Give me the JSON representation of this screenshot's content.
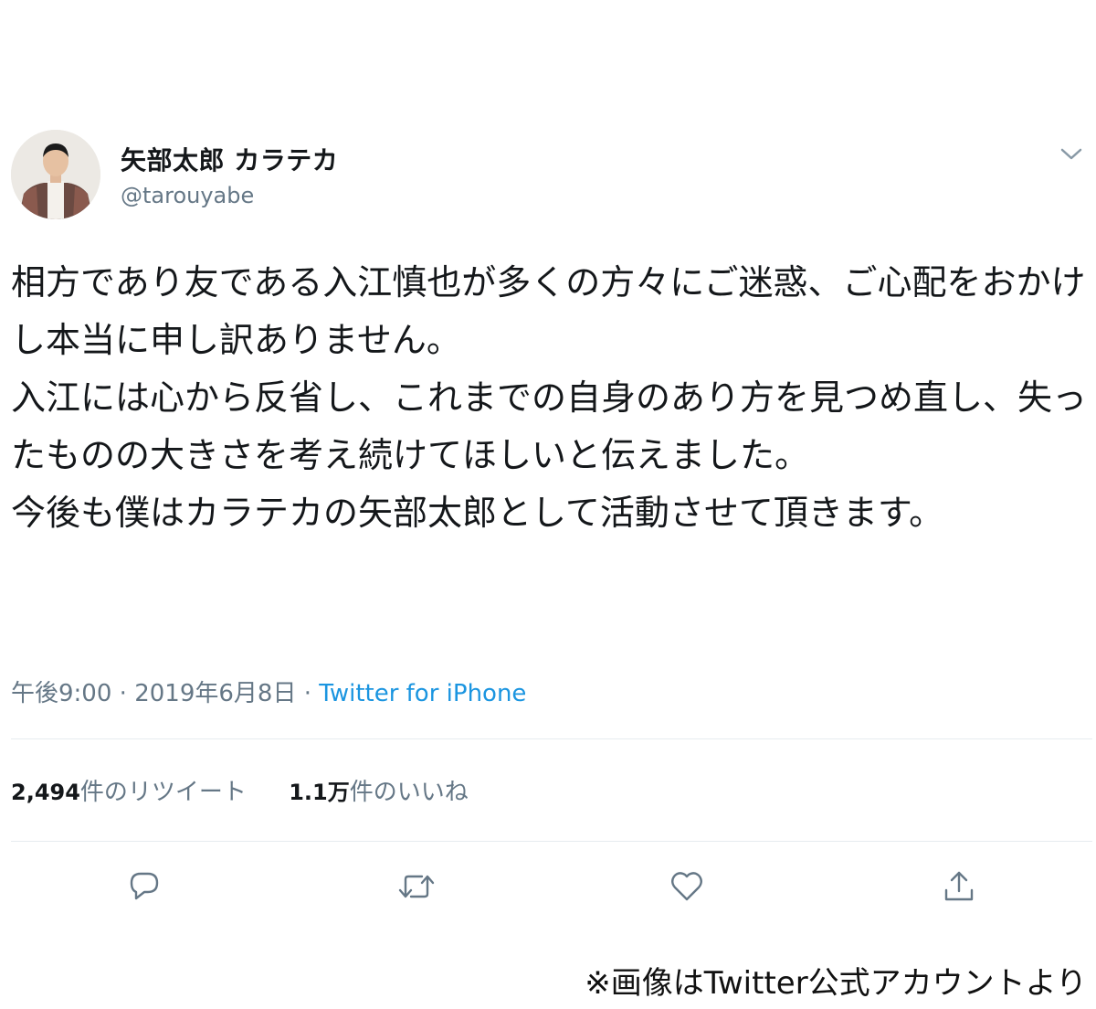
{
  "user": {
    "display_name": "矢部太郎 カラテカ",
    "handle": "@tarouyabe"
  },
  "tweet": {
    "text": "相方であり友である入江慎也が多くの方々にご迷惑、ご心配をおかけし本当に申し訳ありません。\n入江には心から反省し、これまでの自身のあり方を見つめ直し、失ったものの大きさを考え続けてほしいと伝えました。\n今後も僕はカラテカの矢部太郎として活動させて頂きます。",
    "time": "午後9:00",
    "separator1": " · ",
    "date": "2019年6月8日",
    "separator2": " · ",
    "source": "Twitter for iPhone"
  },
  "stats": {
    "retweets_count": "2,494",
    "retweets_label": "件のリツイート",
    "likes_count": "1.1万",
    "likes_label": "件のいいね"
  },
  "actions": [
    "reply-icon",
    "retweet-icon",
    "like-icon",
    "share-icon"
  ],
  "credit": "※画像はTwitter公式アカウントより",
  "colors": {
    "text": "#14171a",
    "secondary": "#657786",
    "link": "#1b95e0",
    "divider": "#e6ecf0"
  }
}
